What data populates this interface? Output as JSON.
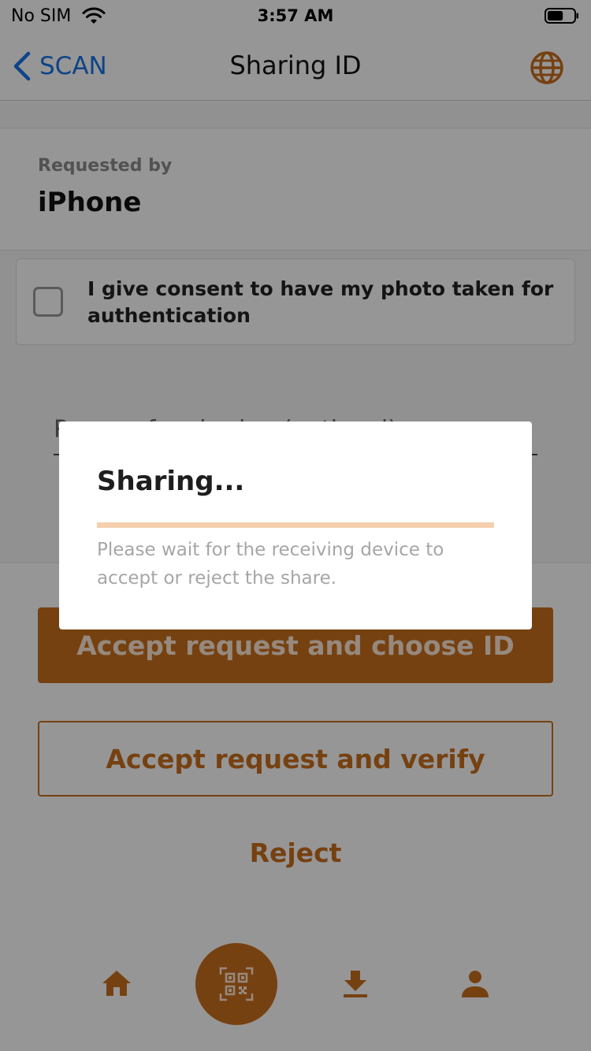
{
  "status_bar": {
    "carrier": "No SIM",
    "time": "3:57 AM",
    "battery_level": 0.6
  },
  "nav": {
    "back_label": "SCAN",
    "title": "Sharing ID",
    "right_icon": "globe-icon"
  },
  "request": {
    "label": "Requested by",
    "value": "iPhone"
  },
  "consent": {
    "checked": false,
    "text": "I give consent to have my photo taken for authentication"
  },
  "reason": {
    "placeholder": "Reason for sharing (optional)",
    "value": ""
  },
  "actions": {
    "primary": "Accept request and choose ID",
    "secondary": "Accept request and verify",
    "tertiary": "Reject"
  },
  "tab_bar": {
    "tabs": [
      "home-icon",
      "qr-scan-icon",
      "download-icon",
      "profile-icon"
    ],
    "active": "qr-scan-icon"
  },
  "dialog": {
    "title": "Sharing...",
    "message": "Please wait for the receiving device to accept or reject the share.",
    "progress": 0
  },
  "colors": {
    "accent": "#c96f1e",
    "link": "#1a74e8",
    "progress_track": "#f5cfae"
  }
}
